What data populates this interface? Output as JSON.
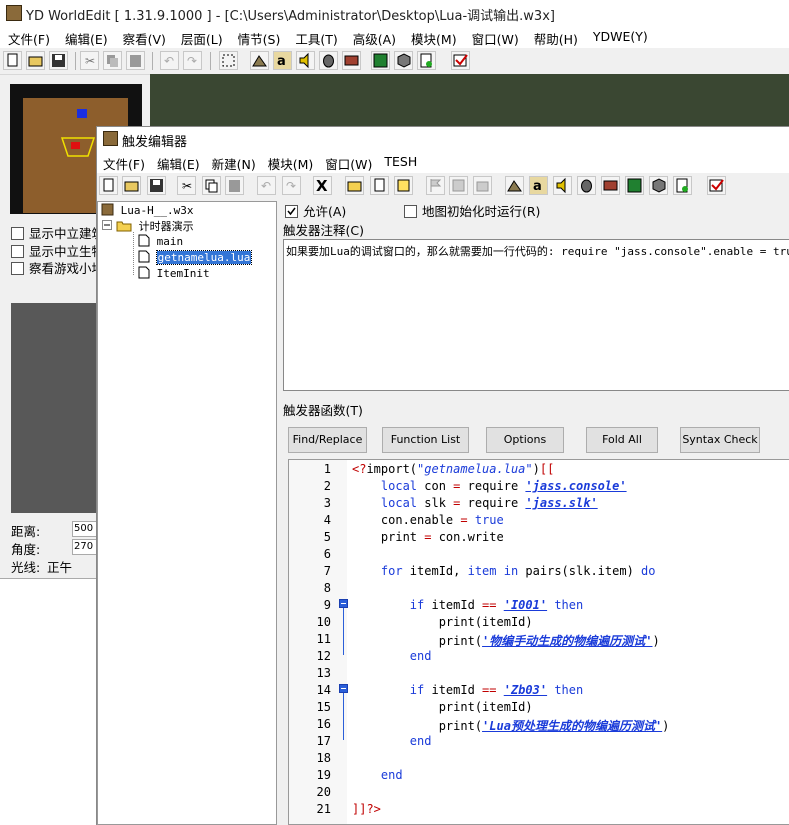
{
  "app": {
    "title": "YD WorldEdit [ 1.31.9.1000 ] - [C:\\Users\\Administrator\\Desktop\\Lua-调试输出.w3x]",
    "menu": [
      "文件(F)",
      "编辑(E)",
      "察看(V)",
      "层面(L)",
      "情节(S)",
      "工具(T)",
      "高级(A)",
      "模块(M)",
      "窗口(W)",
      "帮助(H)",
      "YDWE(Y)"
    ]
  },
  "left_panel": {
    "checkboxes": [
      "显示中立建筑",
      "显示中立生物",
      "察看游戏小地图"
    ],
    "stats": [
      {
        "label": "距离:",
        "value": "500"
      },
      {
        "label": "角度:",
        "value": "270"
      },
      {
        "label": "光线:",
        "value": "正午"
      }
    ]
  },
  "trigger_editor": {
    "title": "触发编辑器",
    "menu": [
      "文件(F)",
      "编辑(E)",
      "新建(N)",
      "模块(M)",
      "窗口(W)",
      "TESH"
    ],
    "tree": {
      "root": "Lua-H__.w3x",
      "category": "计时器演示",
      "items": [
        "main",
        "getnamelua.lua",
        "ItemInit"
      ],
      "selected": "getnamelua.lua"
    },
    "enable_label": "允许(A)",
    "map_init_label": "地图初始化时运行(R)",
    "comment_label": "触发器注释(C)",
    "comment_text": "如果要加Lua的调试窗口的，那么就需要加一行代码的: require \"jass.console\".enable = tru",
    "function_label": "触发器函数(T)",
    "buttons": [
      "Find/Replace",
      "Function List",
      "Options",
      "Fold All",
      "Syntax Check"
    ],
    "line_numbers": [
      "1",
      "2",
      "3",
      "4",
      "5",
      "6",
      "7",
      "8",
      "9",
      "10",
      "11",
      "12",
      "13",
      "14",
      "15",
      "16",
      "17",
      "18",
      "19",
      "20",
      "21"
    ],
    "fold_markers": [
      "9",
      "14"
    ]
  },
  "code_colors": {
    "keyword": "#1a3bd9",
    "operator": "#c00000",
    "selection": "#3375d6"
  }
}
